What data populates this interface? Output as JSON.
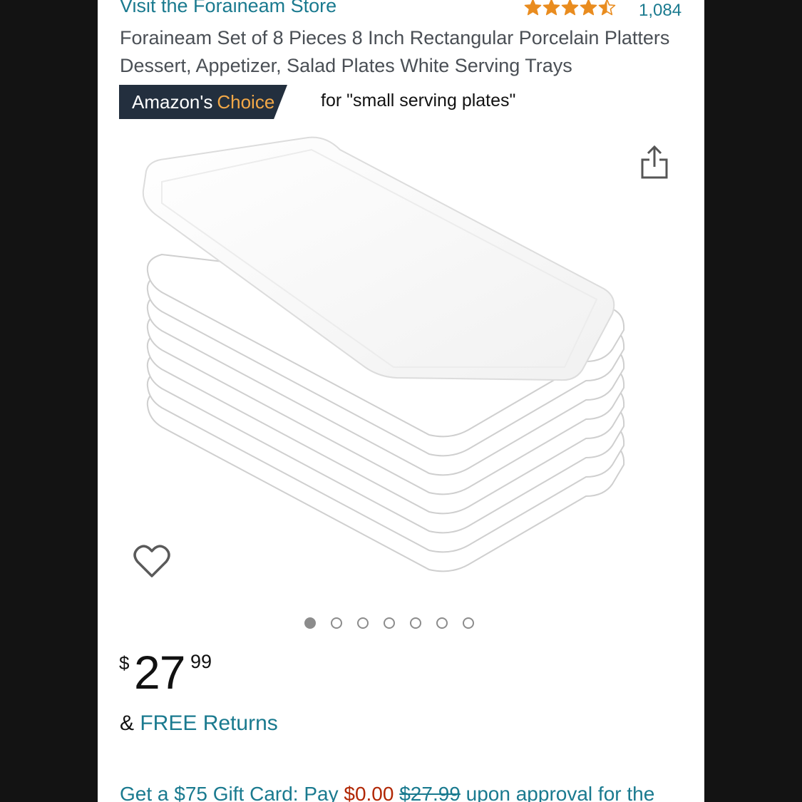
{
  "store": {
    "link_text": "Visit the Foraineam Store"
  },
  "rating": {
    "stars": 4.5,
    "review_count": "1,084",
    "star_color": "#e98c1f"
  },
  "product": {
    "title": "Foraineam Set of 8 Pieces 8 Inch Rectangular Porcelain Platters Dessert, Appetizer, Salad Plates White Serving Trays",
    "image_icon": "plate-stack-image"
  },
  "badge": {
    "prefix": "Amazon's",
    "highlight": "Choice",
    "for_text": "for \"small serving plates\"",
    "bg_color": "#232f3e",
    "highlight_color": "#f3a847"
  },
  "actions": {
    "share_icon": "share-icon",
    "wishlist_icon": "heart-icon"
  },
  "carousel": {
    "count": 7,
    "active_index": 0
  },
  "price": {
    "currency": "$",
    "whole": "27",
    "fraction": "99"
  },
  "returns": {
    "prefix": "& ",
    "link": "FREE Returns"
  },
  "gift_offer": {
    "text_start": "Get a $75 Gift Card: Pay ",
    "new_price": "$0.00",
    "old_price": "$27.99",
    "text_end": " upon approval for the"
  },
  "colors": {
    "link": "#1a7a8f",
    "price_red": "#b12704"
  }
}
